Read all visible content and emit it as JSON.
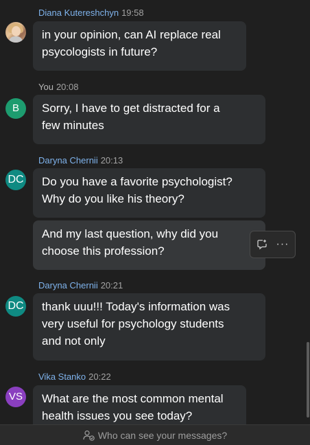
{
  "messages": [
    {
      "sender": "Diana Kutereshchyn",
      "time": "19:58",
      "lines": [
        "in your opinion, can AI replace real",
        "psycologists in future?"
      ]
    },
    {
      "sender": "You",
      "time": "20:08",
      "avatar": "B",
      "lines": [
        "Sorry, I have to get distracted for a",
        "few minutes"
      ]
    },
    {
      "sender": "Daryna Chernii",
      "time": "20:13",
      "avatar": "DC",
      "lines": [
        "Do you have a favorite psychologist?",
        "Why do you like his theory?"
      ]
    },
    {
      "lines": [
        "And my last question, why did you",
        "choose this profession?"
      ]
    },
    {
      "sender": "Daryna Chernii",
      "time": "20:21",
      "avatar": "DC",
      "lines": [
        "thank uuu!!! Today's information was",
        "very useful for psychology students",
        "and not only"
      ]
    },
    {
      "sender": "Vika Stanko",
      "time": "20:22",
      "avatar": "VS",
      "lines": [
        "What are the most common mental",
        "health issues you see today?"
      ]
    }
  ],
  "hover_actions": {
    "more": "···"
  },
  "footer": {
    "privacy_text": "Who can see your messages?"
  },
  "colors": {
    "background": "#1f1f1f",
    "bubble": "#2d2f31",
    "name_link": "#7fb3ec",
    "avatar_b": "#1d9c6f",
    "avatar_dc": "#0f8a82",
    "avatar_vs": "#8a3fbf"
  }
}
